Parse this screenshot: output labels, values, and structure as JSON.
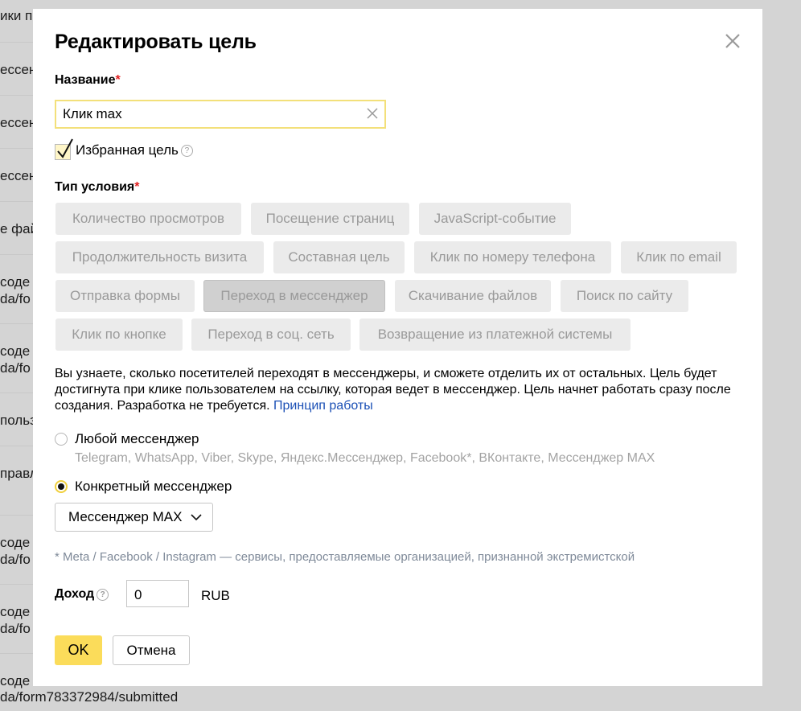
{
  "background": {
    "rows": [
      {
        "text": "ики п"
      },
      {
        "text": "ессенд"
      },
      {
        "text": "ессенд"
      },
      {
        "text": "ессенд"
      },
      {
        "text": "е фай"
      },
      {
        "text": "соде"
      },
      {
        "text": "da/fo"
      },
      {
        "text": "соде"
      },
      {
        "text": "da/fo"
      },
      {
        "text": "польз"
      },
      {
        "text": "правл"
      },
      {
        "text": "соде"
      },
      {
        "text": "da/fo"
      },
      {
        "text": "соде"
      },
      {
        "text": "da/fo"
      },
      {
        "text": "соде"
      },
      {
        "text": "da/form783372984/submitted"
      }
    ]
  },
  "modal": {
    "title": "Редактировать цель",
    "name_label": "Название",
    "required_mark": "*",
    "name_value": "Клик max",
    "favorite_label": "Избранная цель",
    "help_glyph": "?",
    "condition_label": "Тип условия",
    "chips": [
      {
        "label": "Количество просмотров"
      },
      {
        "label": "Посещение страниц"
      },
      {
        "label": "JavaScript-событие"
      },
      {
        "label": "Продолжительность визита"
      },
      {
        "label": "Составная цель"
      },
      {
        "label": "Клик по номеру телефона"
      },
      {
        "label": "Клик по email"
      },
      {
        "label": "Отправка формы"
      },
      {
        "label": "Переход в мессенджер"
      },
      {
        "label": "Скачивание файлов"
      },
      {
        "label": "Поиск по сайту"
      },
      {
        "label": "Клик по кнопке"
      },
      {
        "label": "Переход в соц. сеть"
      },
      {
        "label": "Возвращение из платежной системы"
      }
    ],
    "description": "Вы узнаете, сколько посетителей переходят в мессенджеры, и сможете отделить их от остальных. Цель будет достигнута при клике пользователем на ссылку, которая ведет в мессенджер. Цель начнет работать сразу после создания. Разработка не требуется.",
    "description_link": "Принцип работы",
    "radio_any_label": "Любой мессенджер",
    "radio_any_sub": "Telegram, WhatsApp, Viber, Skype, Яндекс.Мессенджер, Facebook*, ВКонтакте, Мессенджер MAX",
    "radio_specific_label": "Конкретный мессенджер",
    "messenger_select": "Мессенджер MAX",
    "footnote": "* Meta / Facebook / Instagram — сервисы, предоставляемые организацией, признанной экстремистской",
    "income_label": "Доход",
    "income_value": "0",
    "currency": "RUB",
    "ok_label": "OK",
    "cancel_label": "Отмена"
  },
  "colors": {
    "accent": "#fbdc5a",
    "link": "#1a4fb5",
    "required": "#e02020"
  }
}
